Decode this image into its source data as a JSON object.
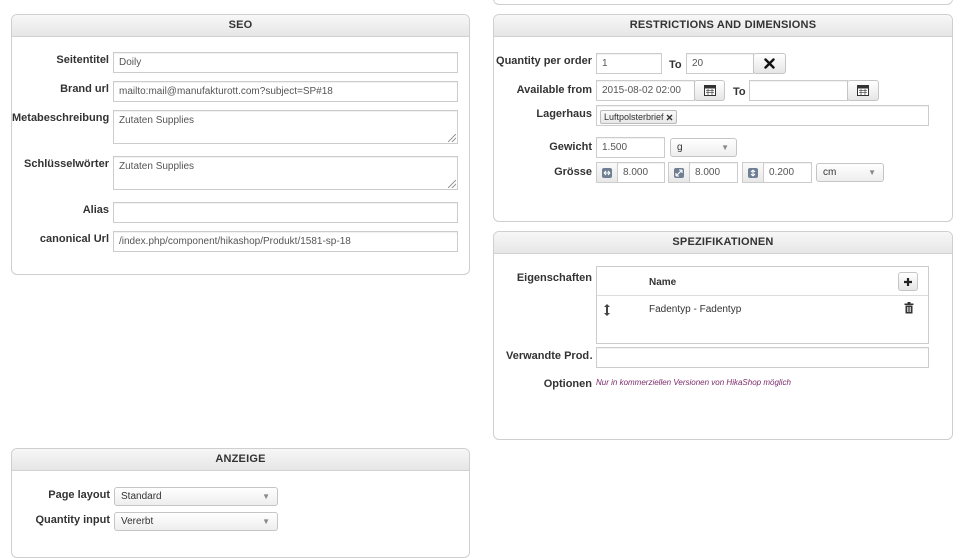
{
  "seo": {
    "title": "SEO",
    "fields": {
      "seitentitel": {
        "label": "Seitentitel",
        "value": "Doily"
      },
      "brand_url": {
        "label": "Brand url",
        "value": "mailto:mail@manufakturott.com?subject=SP#18"
      },
      "metabeschreibung": {
        "label": "Metabeschreibung",
        "value": "Zutaten Supplies"
      },
      "schluesselwoerter": {
        "label": "Schlüsselwörter",
        "value": "Zutaten Supplies"
      },
      "alias": {
        "label": "Alias",
        "value": ""
      },
      "canonical_url": {
        "label": "canonical Url",
        "value": "/index.php/component/hikashop/Produkt/1581-sp-18"
      }
    }
  },
  "restrictions": {
    "title": "RESTRICTIONS AND DIMENSIONS",
    "quantity_per_order": {
      "label": "Quantity per order",
      "from": "1",
      "to_label": "To",
      "to": "20"
    },
    "available_from": {
      "label": "Available from",
      "from": "2015-08-02 02:00",
      "to_label": "To",
      "to": ""
    },
    "lagerhaus": {
      "label": "Lagerhaus",
      "tag": "Luftpolsterbrief"
    },
    "gewicht": {
      "label": "Gewicht",
      "value": "1.500",
      "unit": "g"
    },
    "groesse": {
      "label": "Grösse",
      "length": "8.000",
      "width": "8.000",
      "height": "0.200",
      "unit": "cm"
    }
  },
  "spezifikationen": {
    "title": "SPEZIFIKATIONEN",
    "eigenschaften_label": "Eigenschaften",
    "table_header_name": "Name",
    "rows": [
      {
        "name": "Fadentyp - Fadentyp"
      }
    ],
    "verwandte_label": "Verwandte Prod…",
    "verwandte_value": "",
    "optionen_label": "Optionen",
    "optionen_note": "Nur in kommerziellen Versionen von HikaShop möglich"
  },
  "anzeige": {
    "title": "ANZEIGE",
    "page_layout": {
      "label": "Page layout",
      "value": "Standard"
    },
    "quantity_input": {
      "label": "Quantity input",
      "value": "Vererbt"
    }
  },
  "icons": {
    "remove": "close-icon",
    "calendar": "calendar-icon",
    "add": "plus-icon",
    "drag": "drag-handle-icon",
    "delete": "trash-icon",
    "dimension": "dimension-icon"
  }
}
